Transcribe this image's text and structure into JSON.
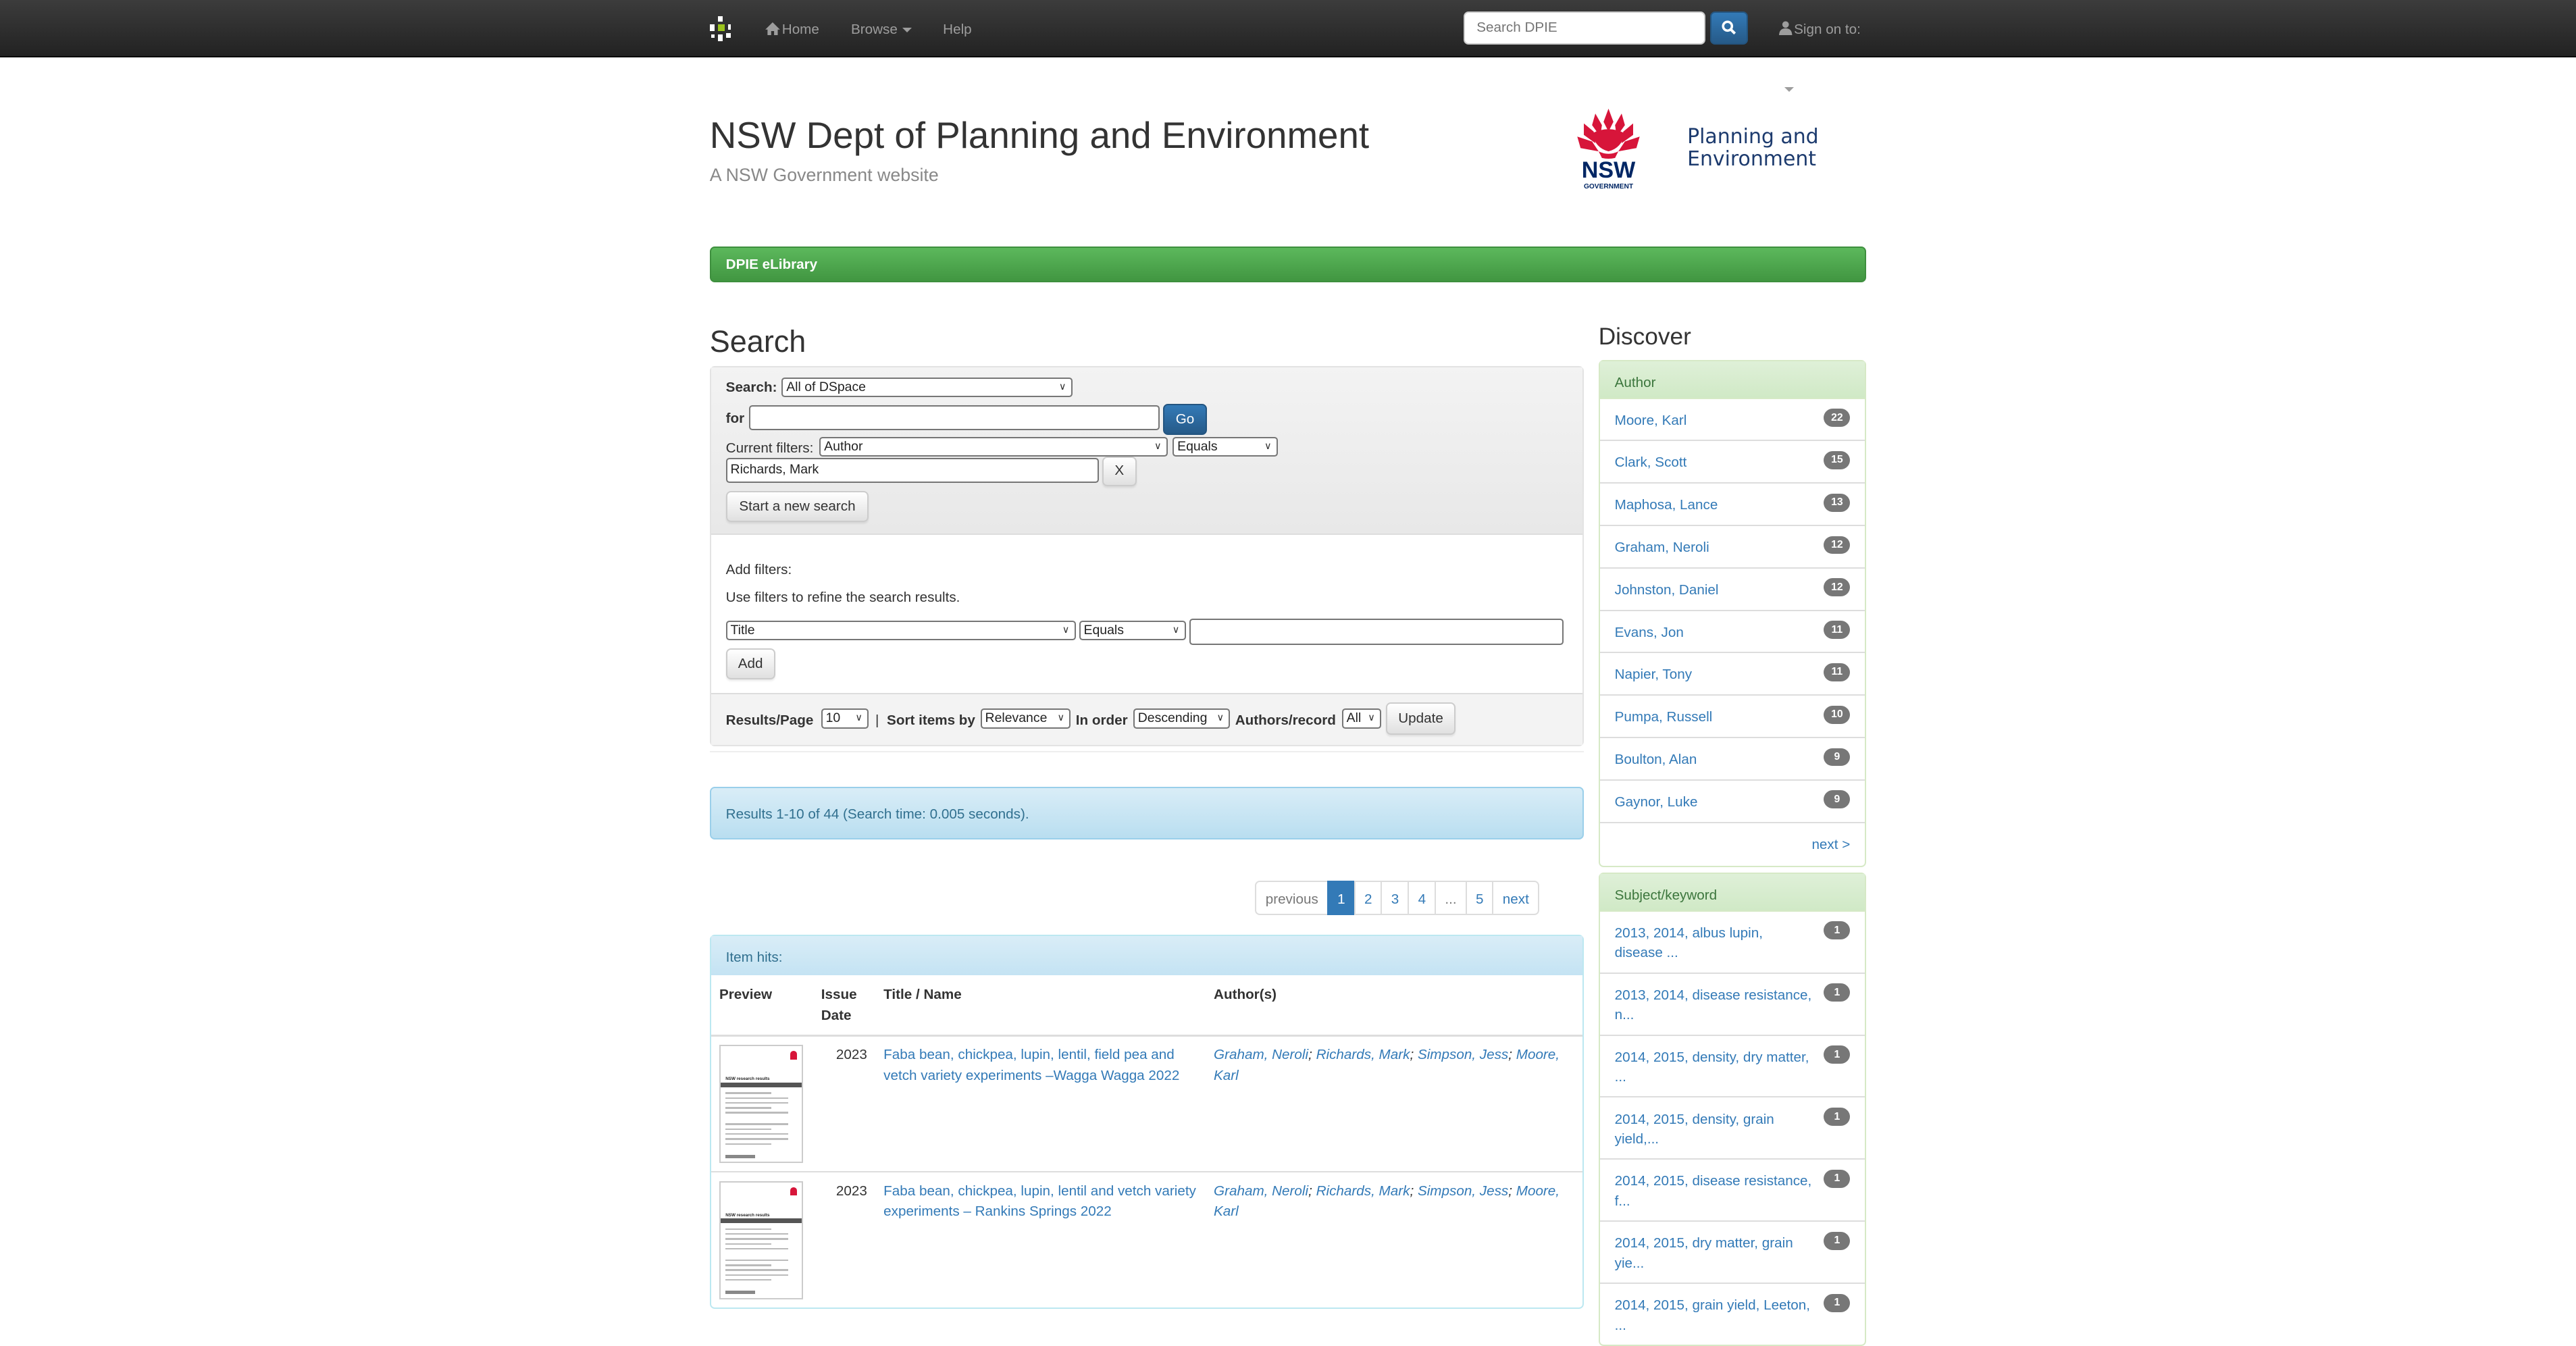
{
  "navbar": {
    "home_label": "Home",
    "browse_label": "Browse",
    "help_label": "Help",
    "search_placeholder": "Search DPIE",
    "signon_label": "Sign on to:"
  },
  "header": {
    "title": "NSW Dept of Planning and Environment",
    "subtitle": "A NSW Government website",
    "logo_mark": "NSW",
    "logo_gov": "GOVERNMENT",
    "logo_line1": "Planning and",
    "logo_line2": "Environment"
  },
  "banner": {
    "label": "DPIE eLibrary"
  },
  "search": {
    "heading": "Search",
    "scope_label": "Search:",
    "scope_value": "All of DSpace",
    "for_label": "for",
    "query_value": "",
    "go_label": "Go",
    "current_filters_label": "Current filters:",
    "current_filter_field": "Author",
    "current_filter_op": "Equals",
    "current_filter_value": "Richards, Mark",
    "remove_filter_label": "X",
    "new_search_label": "Start a new search",
    "add_filters_label": "Add filters:",
    "add_filters_help": "Use filters to refine the search results.",
    "new_filter_field": "Title",
    "new_filter_op": "Equals",
    "new_filter_value": "",
    "add_label": "Add",
    "results_per_page_label": "Results/Page",
    "results_per_page_value": "10",
    "separator": "|",
    "sort_by_label": "Sort items by",
    "sort_by_value": "Relevance",
    "order_label": "In order",
    "order_value": "Descending",
    "authors_record_label": "Authors/record",
    "authors_record_value": "All",
    "update_label": "Update"
  },
  "results": {
    "summary": "Results 1-10 of 44 (Search time: 0.005 seconds).",
    "pagination": [
      "previous",
      "1",
      "2",
      "3",
      "4",
      "...",
      "5",
      "next"
    ],
    "current_page": "1",
    "item_hits_label": "Item hits:",
    "columns": [
      "Preview",
      "Issue Date",
      "Title / Name",
      "Author(s)"
    ],
    "rows": [
      {
        "date": "2023",
        "title": "Faba bean, chickpea, lupin, lentil, field pea and vetch variety experiments –Wagga Wagga 2022",
        "authors": [
          "Graham, Neroli",
          "Richards, Mark",
          "Simpson, Jess",
          "Moore, Karl"
        ],
        "thumb_title": "NSW research results"
      },
      {
        "date": "2023",
        "title": "Faba bean, chickpea, lupin, lentil and vetch variety experiments – Rankins Springs 2022",
        "authors": [
          "Graham, Neroli",
          "Richards, Mark",
          "Simpson, Jess",
          "Moore, Karl"
        ],
        "thumb_title": "NSW research results"
      }
    ]
  },
  "discover": {
    "heading": "Discover",
    "author": {
      "title": "Author",
      "items": [
        {
          "label": "Moore, Karl",
          "count": "22"
        },
        {
          "label": "Clark, Scott",
          "count": "15"
        },
        {
          "label": "Maphosa, Lance",
          "count": "13"
        },
        {
          "label": "Graham, Neroli",
          "count": "12"
        },
        {
          "label": "Johnston, Daniel",
          "count": "12"
        },
        {
          "label": "Evans, Jon",
          "count": "11"
        },
        {
          "label": "Napier, Tony",
          "count": "11"
        },
        {
          "label": "Pumpa, Russell",
          "count": "10"
        },
        {
          "label": "Boulton, Alan",
          "count": "9"
        },
        {
          "label": "Gaynor, Luke",
          "count": "9"
        }
      ],
      "next_label": "next >"
    },
    "subject": {
      "title": "Subject/keyword",
      "items": [
        {
          "label": "2013, 2014, albus lupin, disease ...",
          "count": "1"
        },
        {
          "label": "2013, 2014, disease resistance, n...",
          "count": "1"
        },
        {
          "label": "2014, 2015, density, dry matter, ...",
          "count": "1"
        },
        {
          "label": "2014, 2015, density, grain yield,...",
          "count": "1"
        },
        {
          "label": "2014, 2015, disease resistance, f...",
          "count": "1"
        },
        {
          "label": "2014, 2015, dry matter, grain yie...",
          "count": "1"
        },
        {
          "label": "2014, 2015, grain yield, Leeton, ...",
          "count": "1"
        }
      ]
    }
  },
  "colors": {
    "navbar_bg": "#222222",
    "brand_green": "#9bc31c",
    "primary_blue": "#337ab7",
    "banner_green": "#5cb85c",
    "nsw_red": "#d7153a",
    "nsw_navy": "#002664",
    "badge_gray": "#777777"
  }
}
